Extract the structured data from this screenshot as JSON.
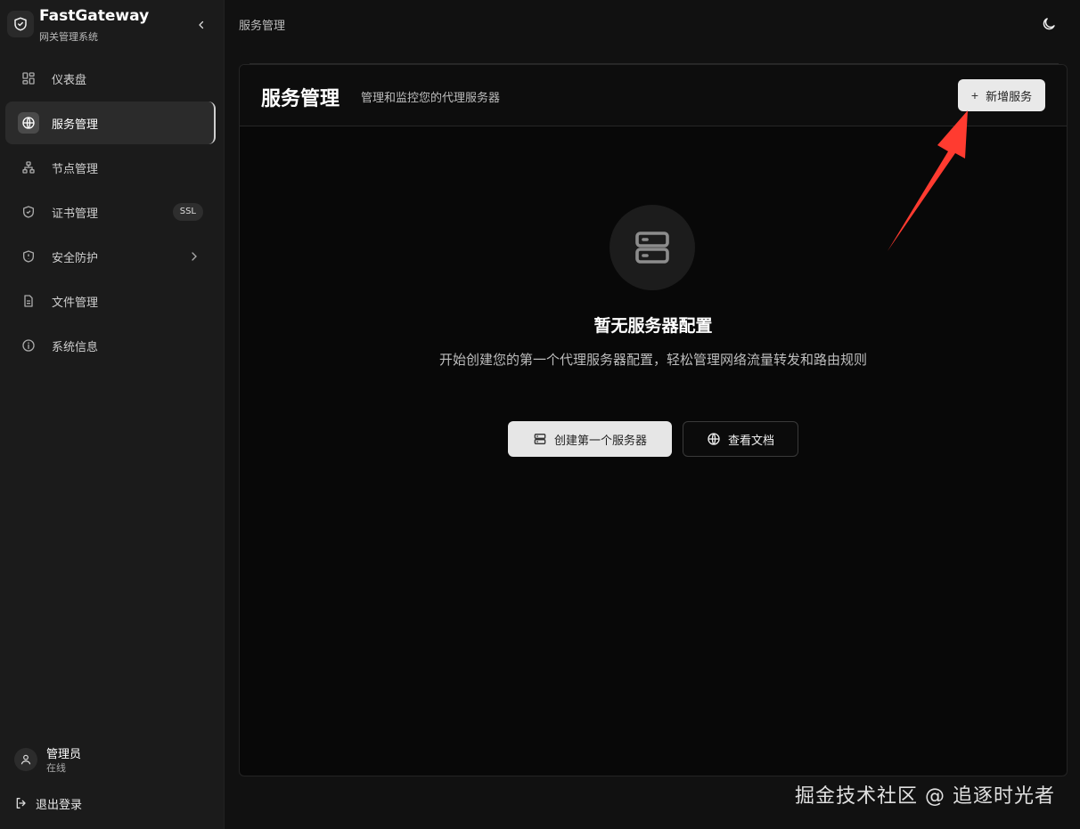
{
  "brand": {
    "title": "FastGateway",
    "subtitle": "网关管理系统",
    "icon": "shield-icon"
  },
  "sidebar": {
    "items": [
      {
        "label": "仪表盘",
        "icon": "dashboard-icon"
      },
      {
        "label": "服务管理",
        "icon": "globe-icon",
        "active": true
      },
      {
        "label": "节点管理",
        "icon": "nodes-icon"
      },
      {
        "label": "证书管理",
        "icon": "shield-check-icon",
        "badge": "SSL"
      },
      {
        "label": "安全防护",
        "icon": "shield-icon",
        "has_submenu": true
      },
      {
        "label": "文件管理",
        "icon": "file-icon"
      },
      {
        "label": "系统信息",
        "icon": "info-icon"
      }
    ]
  },
  "user": {
    "name": "管理员",
    "status": "在线"
  },
  "logout": {
    "label": "退出登录"
  },
  "breadcrumb": "服务管理",
  "header": {
    "title": "服务管理",
    "description": "管理和监控您的代理服务器",
    "add_button": "新增服务"
  },
  "empty_state": {
    "icon": "server-icon",
    "title": "暂无服务器配置",
    "description": "开始创建您的第一个代理服务器配置，轻松管理网络流量转发和路由规则",
    "create_button": "创建第一个服务器",
    "docs_button": "查看文档"
  },
  "watermark": "掘金技术社区 @ 追逐时光者",
  "colors": {
    "background": "#111111",
    "sidebar": "#1b1b1b",
    "panel": "#080808",
    "accent_arrow": "#ff3b30"
  }
}
